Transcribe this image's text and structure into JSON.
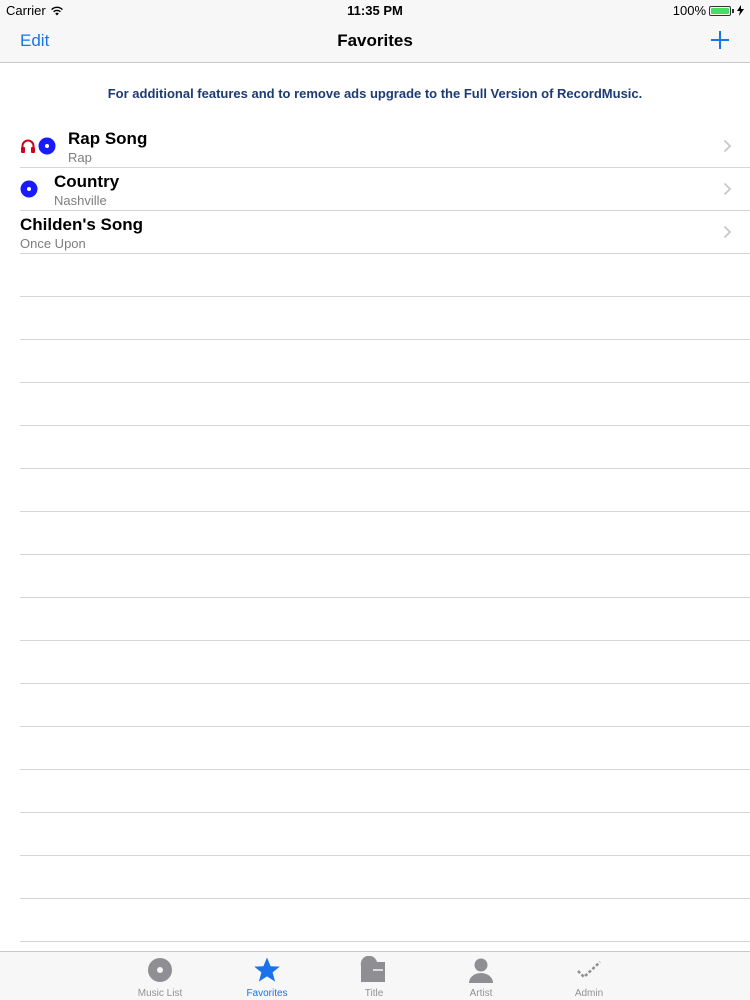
{
  "status_bar": {
    "carrier": "Carrier",
    "time": "11:35 PM",
    "battery_percent": "100%",
    "battery_level": 1.0
  },
  "nav": {
    "edit_label": "Edit",
    "title": "Favorites",
    "add_icon": "plus-icon"
  },
  "banner": {
    "text": "For additional features and to remove ads upgrade to the Full Version of RecordMusic."
  },
  "list": {
    "items": [
      {
        "title": "Rap Song",
        "subtitle": "Rap",
        "icons": [
          "headphones-icon",
          "record-icon"
        ]
      },
      {
        "title": "Country",
        "subtitle": "Nashville",
        "icons": [
          "record-icon"
        ]
      },
      {
        "title": "Childen's Song",
        "subtitle": "Once Upon",
        "icons": []
      }
    ]
  },
  "tab_bar": {
    "tabs": [
      {
        "label": "Music List",
        "icon": "disc-icon",
        "active": false
      },
      {
        "label": "Favorites",
        "icon": "star-icon",
        "active": true
      },
      {
        "label": "Title",
        "icon": "folder-icon",
        "active": false
      },
      {
        "label": "Artist",
        "icon": "person-icon",
        "active": false
      },
      {
        "label": "Admin",
        "icon": "check-icon",
        "active": false
      }
    ]
  },
  "colors": {
    "accent": "#1a73e8",
    "banner_text": "#1d3b73",
    "record_blue": "#1a1aff",
    "headphones_red": "#d0021b",
    "battery_green": "#4cd964",
    "tab_inactive": "#929292"
  }
}
